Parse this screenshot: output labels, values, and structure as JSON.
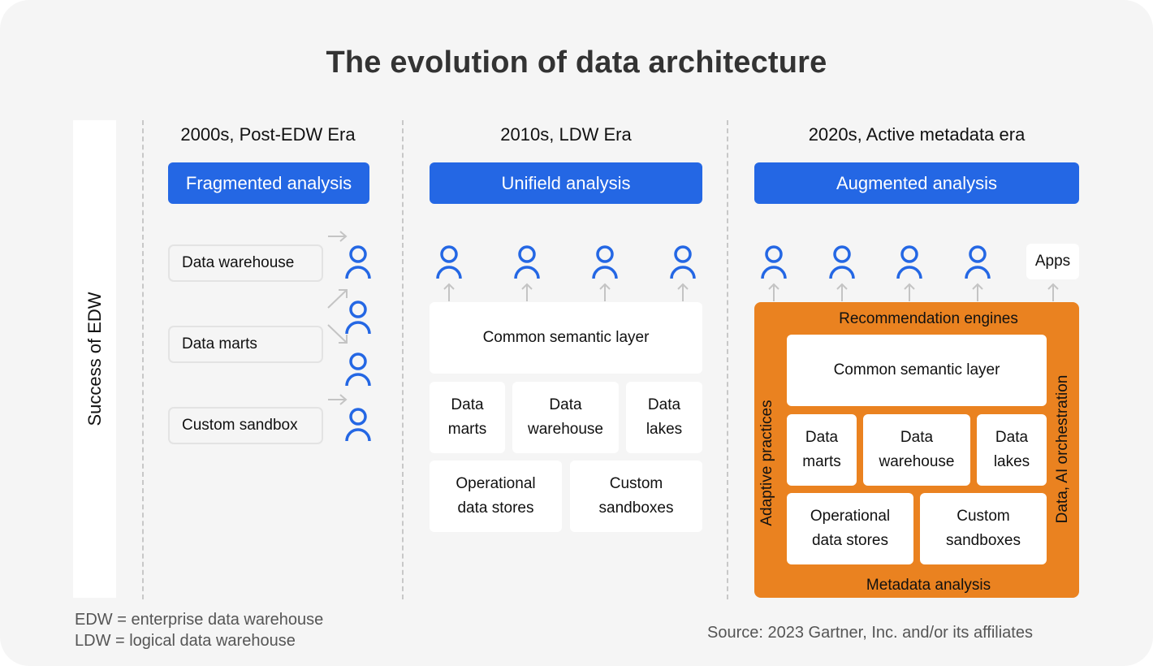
{
  "title": "The evolution of data architecture",
  "side_label": "Success of EDW",
  "colors": {
    "accent_blue": "#2467e4",
    "orange": "#ea8220",
    "background": "#f5f5f5",
    "box": "#ffffff",
    "arrow": "#c4c4c4"
  },
  "eras": [
    {
      "title": "2000s, Post-EDW Era",
      "banner": "Fragmented analysis",
      "sources": [
        "Data warehouse",
        "Data marts",
        "Custom sandbox"
      ],
      "user_icon": "user-icon"
    },
    {
      "title": "2010s, LDW Era",
      "banner": "Unifield analysis",
      "layer": "Common semantic layer",
      "stores_row1": [
        "Data\nmarts",
        "Data\nwarehouse",
        "Data\nlakes"
      ],
      "stores_row2": [
        "Operational\ndata stores",
        "Custom\nsandboxes"
      ],
      "user_icon": "user-icon"
    },
    {
      "title": "2020s, Active metadata era",
      "banner": "Augmented analysis",
      "apps": "Apps",
      "top_label": "Recommendation engines",
      "bottom_label": "Metadata analysis",
      "left_label": "Adaptive practices",
      "right_label": "Data, AI orchestration",
      "layer": "Common semantic layer",
      "stores_row1": [
        "Data\nmarts",
        "Data\nwarehouse",
        "Data\nlakes"
      ],
      "stores_row2": [
        "Operational\ndata stores",
        "Custom\nsandboxes"
      ],
      "user_icon": "user-icon"
    }
  ],
  "footnotes": {
    "edw": "EDW = enterprise data warehouse",
    "ldw": "LDW = logical data warehouse",
    "source": "Source: 2023 Gartner, Inc. and/or its affiliates"
  }
}
